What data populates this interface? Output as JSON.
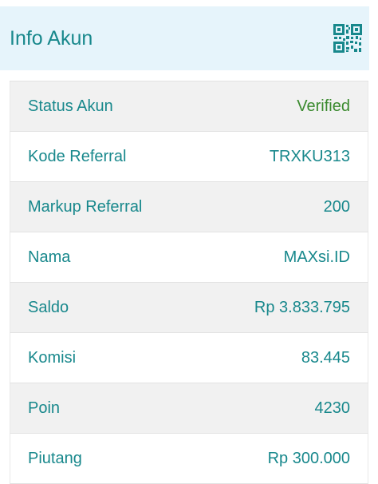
{
  "header": {
    "title": "Info Akun",
    "qr_icon": "qr-code-icon"
  },
  "colors": {
    "text": "#18888c",
    "verified": "#3a8a2e",
    "header_bg": "#e6f4fb",
    "row_alt_bg": "#f1f1f1"
  },
  "rows": [
    {
      "label": "Status Akun",
      "value": "Verified"
    },
    {
      "label": "Kode Referral",
      "value": "TRXKU313"
    },
    {
      "label": "Markup Referral",
      "value": "200"
    },
    {
      "label": "Nama",
      "value": "MAXsi.ID"
    },
    {
      "label": "Saldo",
      "value": "Rp 3.833.795"
    },
    {
      "label": "Komisi",
      "value": "83.445"
    },
    {
      "label": "Poin",
      "value": "4230"
    },
    {
      "label": "Piutang",
      "value": "Rp 300.000"
    }
  ]
}
